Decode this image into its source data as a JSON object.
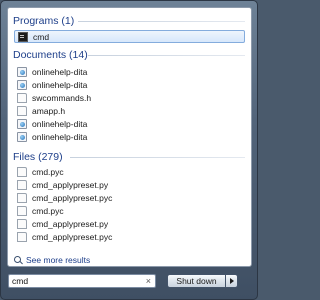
{
  "programs": {
    "header": "Programs (1)",
    "items": [
      {
        "label": "cmd",
        "icon": "console-icon",
        "selected": true
      }
    ]
  },
  "documents": {
    "header": "Documents (14)",
    "items": [
      {
        "label": "onlinehelp-dita",
        "icon": "help-file-icon"
      },
      {
        "label": "onlinehelp-dita",
        "icon": "help-file-icon"
      },
      {
        "label": "swcommands.h",
        "icon": "document-icon"
      },
      {
        "label": "amapp.h",
        "icon": "document-icon"
      },
      {
        "label": "onlinehelp-dita",
        "icon": "help-file-icon"
      },
      {
        "label": "onlinehelp-dita",
        "icon": "help-file-icon"
      }
    ]
  },
  "files": {
    "header": "Files (279)",
    "items": [
      {
        "label": "cmd.pyc",
        "icon": "document-icon"
      },
      {
        "label": "cmd_applypreset.py",
        "icon": "document-icon"
      },
      {
        "label": "cmd_applypreset.pyc",
        "icon": "document-icon"
      },
      {
        "label": "cmd.pyc",
        "icon": "document-icon"
      },
      {
        "label": "cmd_applypreset.py",
        "icon": "document-icon"
      },
      {
        "label": "cmd_applypreset.pyc",
        "icon": "document-icon"
      }
    ]
  },
  "see_more": "See more results",
  "search": {
    "value": "cmd",
    "clear_glyph": "×"
  },
  "shutdown": {
    "label": "Shut down"
  },
  "colors": {
    "header": "#1e3f8a",
    "selection": "#d7e7fb",
    "frame": "#52647a"
  }
}
